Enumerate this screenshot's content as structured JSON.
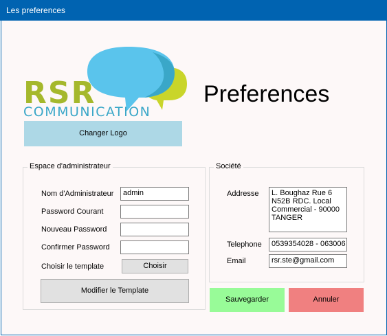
{
  "window": {
    "title": "Les preferences"
  },
  "logo": {
    "line1": "RSR",
    "line2": "COMMUNICATION",
    "colors": {
      "green": "#a5b82c",
      "teal": "#3aa7c8",
      "bubble_blue": "#5ac4ec",
      "bubble_green": "#c9d52a"
    }
  },
  "heading": "Preferences",
  "change_logo_label": "Changer Logo",
  "admin_group": {
    "title": "Espace d'administrateur",
    "name_label": "Nom d'Administrateur",
    "name_value": "admin",
    "current_password_label": "Password Courant",
    "new_password_label": "Nouveau Password",
    "confirm_password_label": "Confirmer Password",
    "template_label": "Choisir le template",
    "choose_label": "Choisir",
    "modify_template_label": "Modifier le Template"
  },
  "company_group": {
    "title": "Société",
    "address_label": "Addresse",
    "address_value": "L. Boughaz Rue 6\nN52B RDC. Local\nCommercial - 90000\nTANGER",
    "phone_label": "Telephone",
    "phone_value": "0539354028 - 063006",
    "email_label": "Email",
    "email_value": "rsr.ste@gmail.com"
  },
  "save_label": "Sauvegarder",
  "cancel_label": "Annuler",
  "colors": {
    "save_bg": "#98fb98",
    "cancel_bg": "#f08080",
    "logo_button_bg": "#add8e6",
    "titlebar": "#0063b1"
  }
}
